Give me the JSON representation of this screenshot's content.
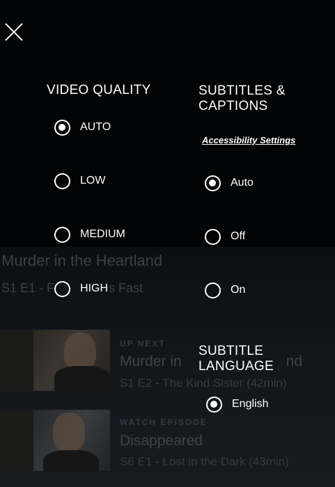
{
  "background": {
    "show_title": "Murder in the Heartland",
    "show_subtitle": "S1 E1 - F",
    "show_subtitle_tail": "s Fast",
    "episodes": [
      {
        "kicker": "UP NEXT",
        "title": "Murder in",
        "title_tail": "nd",
        "meta": "S1 E2 - The Kind Sister (42min)"
      },
      {
        "kicker": "WATCH EPISODE",
        "title": "Disappeared",
        "meta": "S6 E1 - Lost in the Dark (43min)"
      }
    ]
  },
  "close": {
    "icon": "close-icon"
  },
  "video_quality": {
    "heading": "VIDEO QUALITY",
    "options": [
      {
        "label": "AUTO",
        "selected": true
      },
      {
        "label": "LOW",
        "selected": false
      },
      {
        "label": "MEDIUM",
        "selected": false
      },
      {
        "label": "HIGH",
        "selected": false
      }
    ]
  },
  "subtitles": {
    "heading_line1": "SUBTITLES &",
    "heading_line2": "CAPTIONS",
    "accessibility_link": "Accessibility Settings",
    "options": [
      {
        "label": "Auto",
        "selected": true
      },
      {
        "label": "Off",
        "selected": false
      },
      {
        "label": "On",
        "selected": false
      }
    ]
  },
  "subtitle_language": {
    "heading_line1": "SUBTITLE",
    "heading_line2": "LANGUAGE",
    "options": [
      {
        "label": "English",
        "selected": true
      }
    ]
  }
}
